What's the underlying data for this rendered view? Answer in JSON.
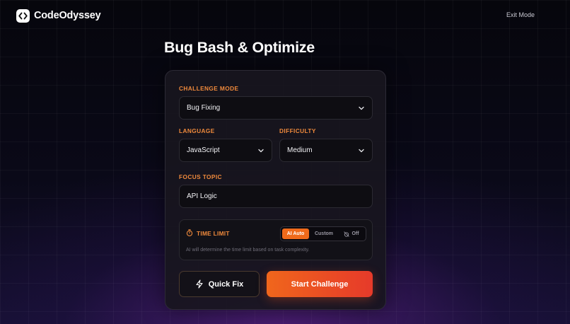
{
  "app": {
    "name": "CodeOdyssey",
    "exit_label": "Exit Mode"
  },
  "page": {
    "title": "Bug Bash & Optimize"
  },
  "form": {
    "challenge_mode": {
      "label": "CHALLENGE MODE",
      "value": "Bug Fixing"
    },
    "language": {
      "label": "LANGUAGE",
      "value": "JavaScript"
    },
    "difficulty": {
      "label": "DIFFICULTY",
      "value": "Medium"
    },
    "focus_topic": {
      "label": "FOCUS TOPIC",
      "value": "API Logic"
    },
    "time_limit": {
      "label": "TIME LIMIT",
      "options": [
        "AI Auto",
        "Custom",
        "Off"
      ],
      "selected": "AI Auto",
      "description": "AI will determine the time limit based on task complexity."
    }
  },
  "actions": {
    "quick_fix": "Quick Fix",
    "start": "Start Challenge"
  },
  "colors": {
    "accent": "#f08a3c",
    "primary_start": "#f0661c",
    "primary_end": "#e63a2a"
  }
}
